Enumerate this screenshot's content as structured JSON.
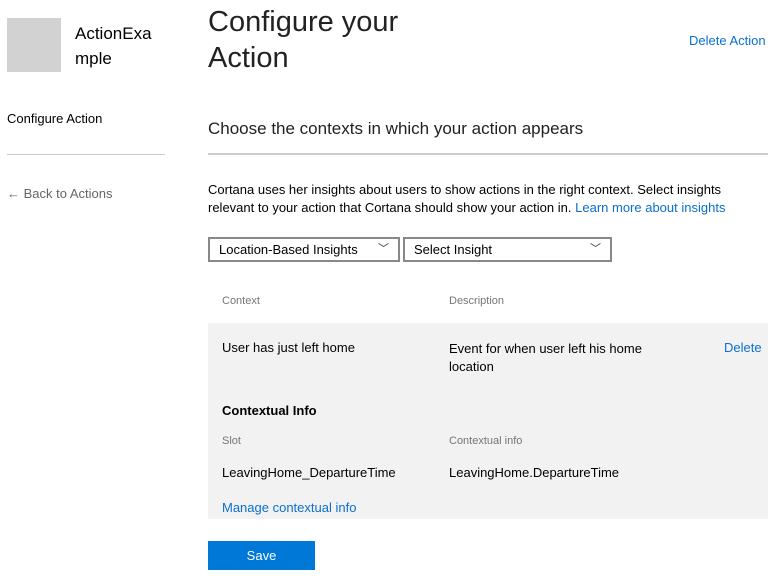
{
  "sidebar": {
    "app_name": "ActionExample",
    "nav_item": "Configure Action",
    "back_link": "Back to Actions"
  },
  "header": {
    "title": "Configure your Action",
    "delete_action": "Delete Action"
  },
  "section": {
    "heading": "Choose the contexts in which your action appears",
    "description": "Cortana uses her insights about users to show actions in the right context. Select insights relevant to your action that Cortana should show your action in.",
    "learn_more": "Learn more about insights"
  },
  "filters": {
    "category": "Location-Based Insights",
    "insight": "Select Insight"
  },
  "table": {
    "headers": {
      "context": "Context",
      "description": "Description"
    },
    "row": {
      "context": "User has just left home",
      "description": "Event for when user left his home location",
      "delete": "Delete"
    },
    "contextual": {
      "heading": "Contextual Info",
      "headers": {
        "slot": "Slot",
        "info": "Contextual info"
      },
      "slot": "LeavingHome_DepartureTime",
      "info": "LeavingHome.DepartureTime",
      "manage": "Manage contextual info"
    }
  },
  "save": "Save",
  "colors": {
    "accent": "#0a6fd0",
    "button": "#0078d7",
    "row_bg": "#f2f2f2",
    "thumbnail": "#d2d2d2"
  }
}
